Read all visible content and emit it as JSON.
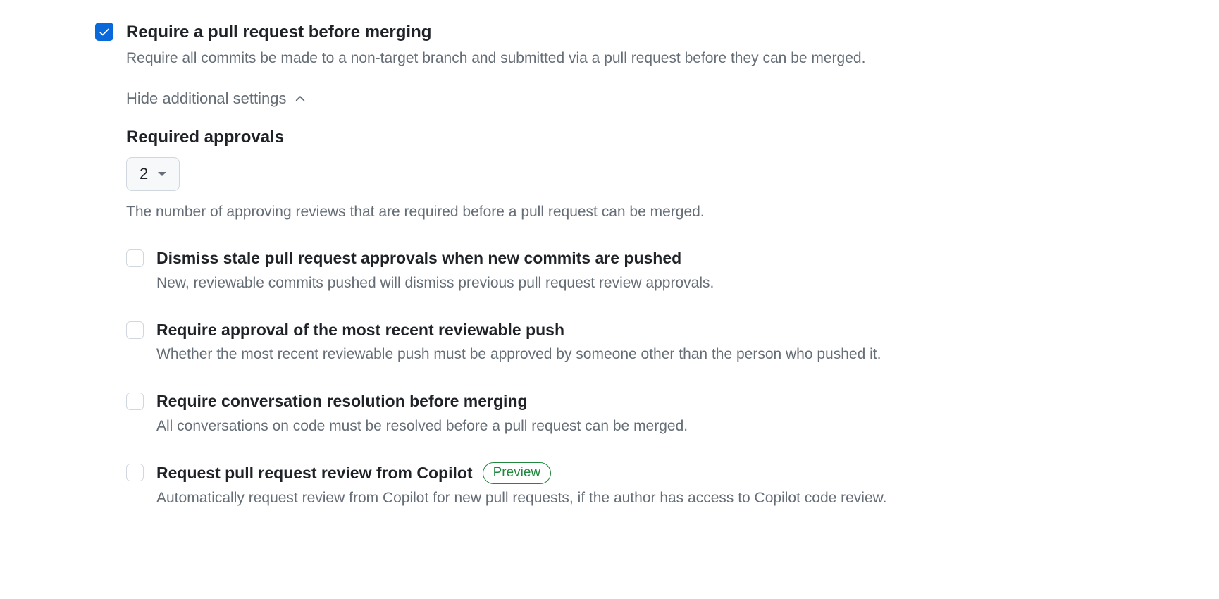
{
  "main": {
    "title": "Require a pull request before merging",
    "description": "Require all commits be made to a non-target branch and submitted via a pull request before they can be merged.",
    "checked": true
  },
  "toggle": {
    "label": "Hide additional settings"
  },
  "approvals": {
    "title": "Required approvals",
    "value": "2",
    "help": "The number of approving reviews that are required before a pull request can be merged."
  },
  "options": [
    {
      "title": "Dismiss stale pull request approvals when new commits are pushed",
      "description": "New, reviewable commits pushed will dismiss previous pull request review approvals.",
      "checked": false,
      "badge": null
    },
    {
      "title": "Require approval of the most recent reviewable push",
      "description": "Whether the most recent reviewable push must be approved by someone other than the person who pushed it.",
      "checked": false,
      "badge": null
    },
    {
      "title": "Require conversation resolution before merging",
      "description": "All conversations on code must be resolved before a pull request can be merged.",
      "checked": false,
      "badge": null
    },
    {
      "title": "Request pull request review from Copilot",
      "description": "Automatically request review from Copilot for new pull requests, if the author has access to Copilot code review.",
      "checked": false,
      "badge": "Preview"
    }
  ]
}
